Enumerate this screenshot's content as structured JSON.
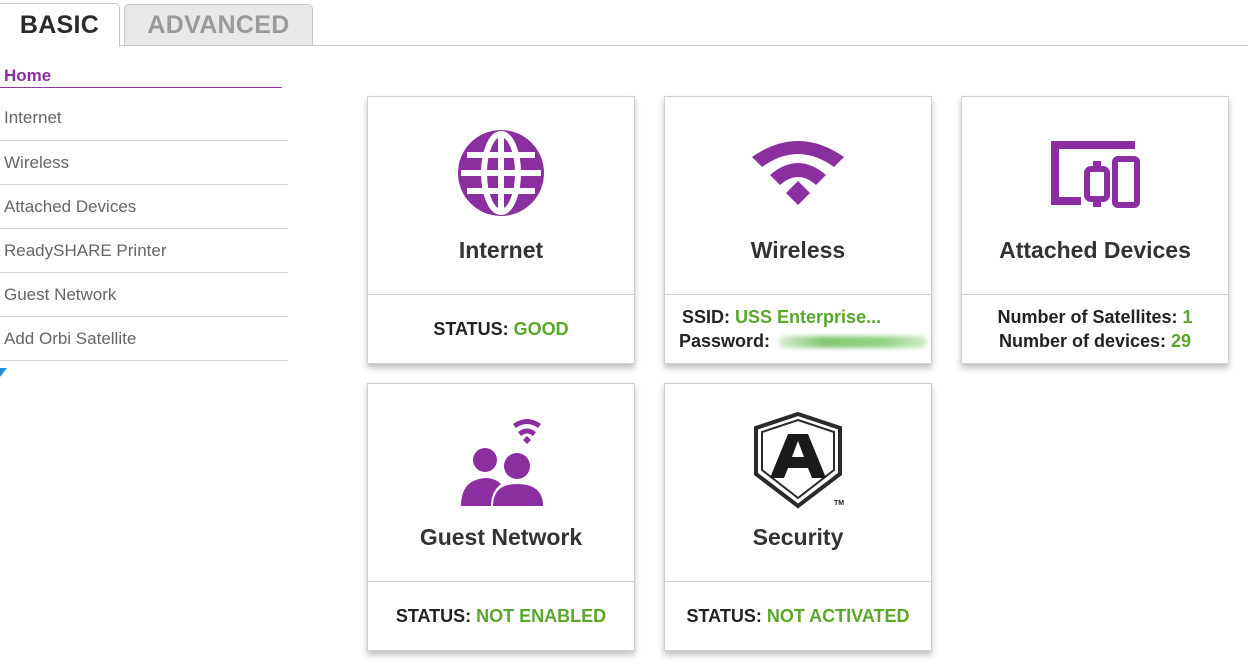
{
  "tabs": {
    "basic": "BASIC",
    "advanced": "ADVANCED"
  },
  "sidebar": {
    "items": [
      {
        "label": "Home",
        "active": true
      },
      {
        "label": "Internet"
      },
      {
        "label": "Wireless"
      },
      {
        "label": "Attached Devices"
      },
      {
        "label": "ReadySHARE Printer"
      },
      {
        "label": "Guest Network"
      },
      {
        "label": "Add Orbi Satellite"
      }
    ]
  },
  "cards": {
    "internet": {
      "icon": "globe-icon",
      "title": "Internet",
      "status_label": "STATUS:",
      "status_value": "GOOD"
    },
    "wireless": {
      "icon": "wifi-icon",
      "title": "Wireless",
      "ssid_label": "SSID:",
      "ssid_value": "USS Enterprise...",
      "password_label": "Password:"
    },
    "attached_devices": {
      "icon": "devices-icon",
      "title": "Attached Devices",
      "satellites_label": "Number of Satellites:",
      "satellites_value": "1",
      "devices_label": "Number of devices:",
      "devices_value": "29"
    },
    "guest_network": {
      "icon": "guest-network-icon",
      "title": "Guest Network",
      "status_label": "STATUS:",
      "status_value": "NOT ENABLED"
    },
    "security": {
      "icon": "armor-shield-icon",
      "title": "Security",
      "status_label": "STATUS:",
      "status_value": "NOT ACTIVATED",
      "trademark": "TM"
    }
  },
  "colors": {
    "accent_purple": "#8b2fa0",
    "status_green": "#5aa82a",
    "text_dark": "#333333"
  }
}
